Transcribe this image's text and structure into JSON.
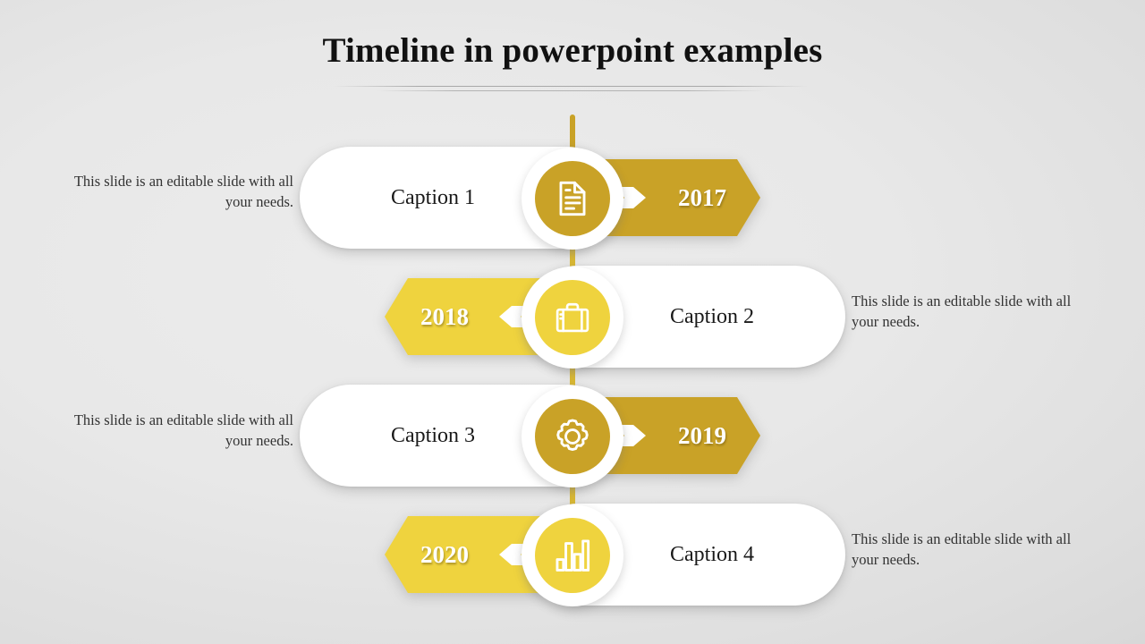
{
  "slide": {
    "title": "Timeline in powerpoint examples",
    "background_color": "#e8e8e8"
  },
  "palette": {
    "gold_dark": "#c9a227",
    "gold_light": "#efd33e",
    "white": "#ffffff",
    "text_dark": "#1a1a1a",
    "text_body": "#333333"
  },
  "timeline": {
    "items": [
      {
        "caption": "Caption 1",
        "year": "2017",
        "icon": "document-icon",
        "color": "#c9a227",
        "side": "badge-right",
        "arrow_direction": "right",
        "description": "This slide is an editable slide with all your needs.",
        "description_side": "left"
      },
      {
        "caption": "Caption 2",
        "year": "2018",
        "icon": "briefcase-icon",
        "color": "#efd33e",
        "side": "badge-left",
        "arrow_direction": "left",
        "description": "This slide is an editable slide with all your needs.",
        "description_side": "right"
      },
      {
        "caption": "Caption 3",
        "year": "2019",
        "icon": "gear-icon",
        "color": "#c9a227",
        "side": "badge-right",
        "arrow_direction": "right",
        "description": "This slide is an editable slide with all your needs.",
        "description_side": "left"
      },
      {
        "caption": "Caption 4",
        "year": "2020",
        "icon": "chart-bar-icon",
        "color": "#efd33e",
        "side": "badge-left",
        "arrow_direction": "left",
        "description": "This slide is an editable slide with all your needs.",
        "description_side": "right"
      }
    ]
  }
}
